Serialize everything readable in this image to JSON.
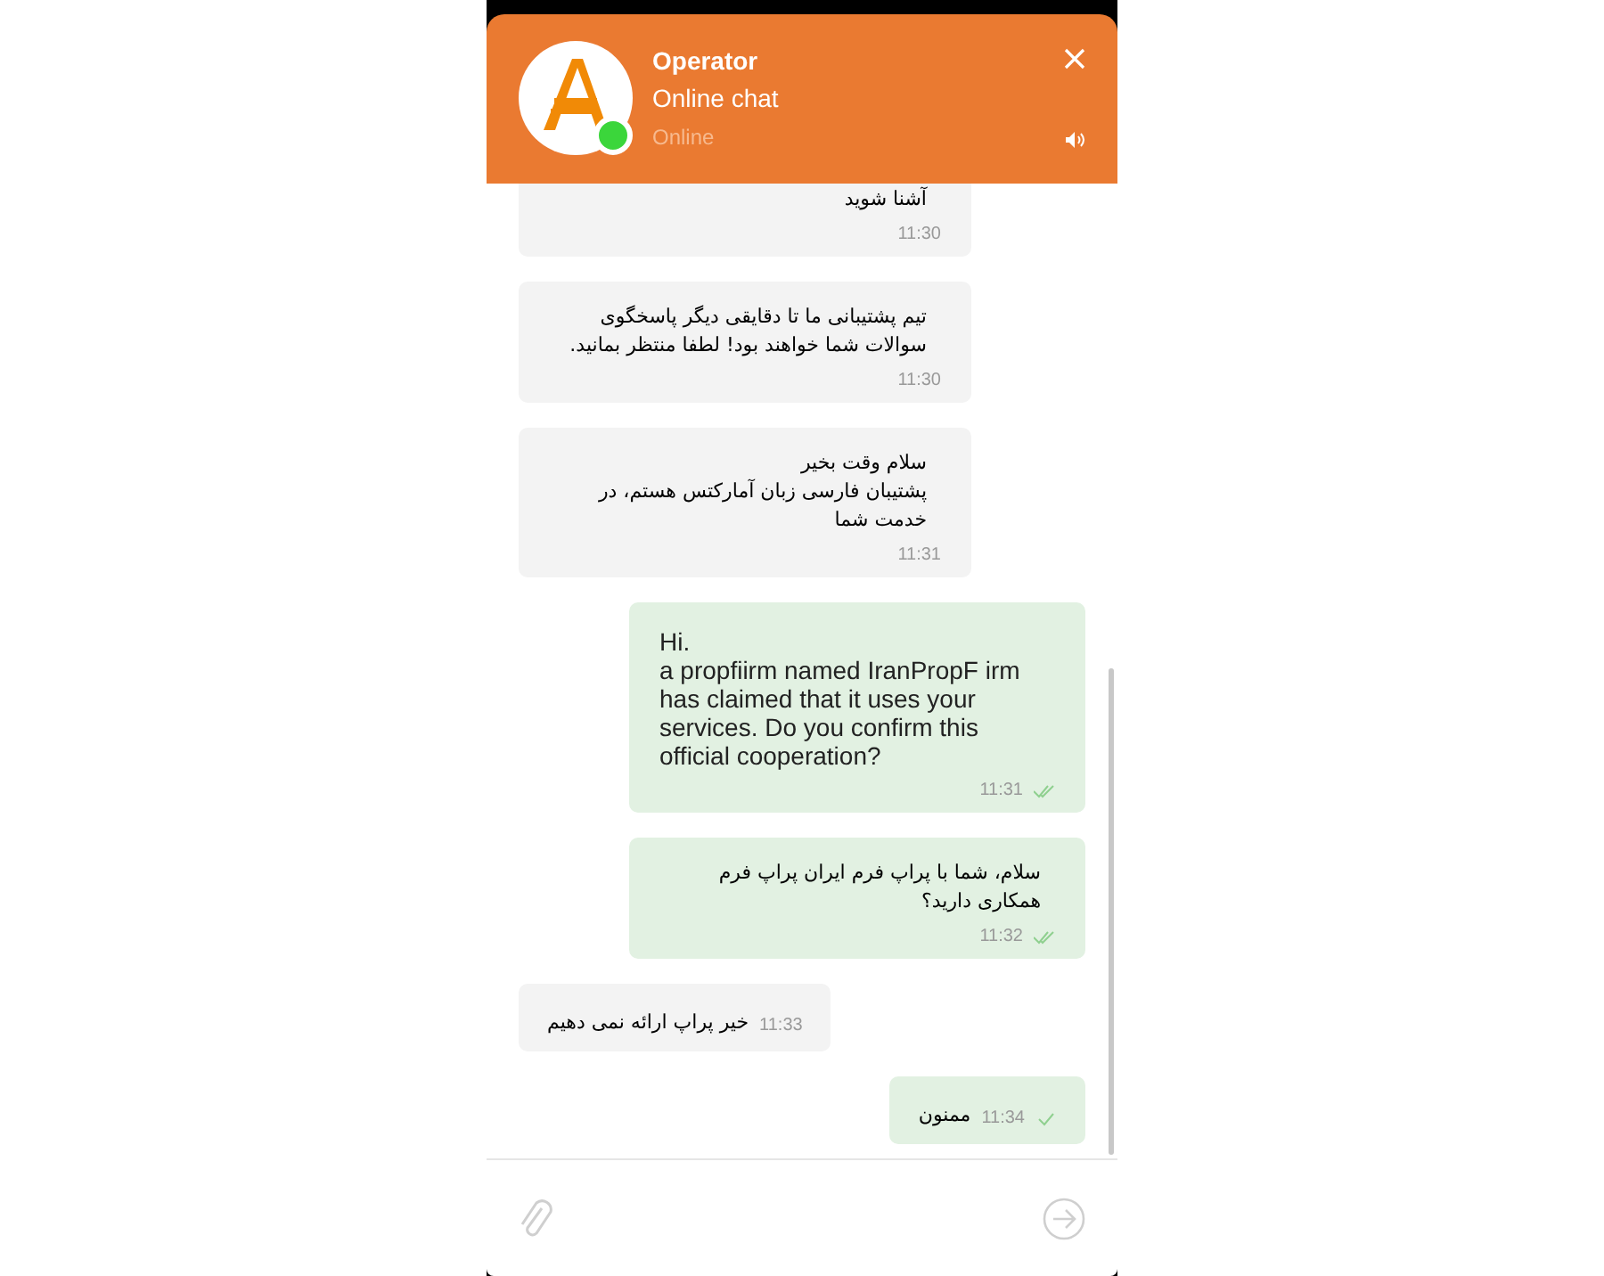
{
  "header": {
    "name": "Operator",
    "subtitle": "Online chat",
    "status": "Online",
    "online": true
  },
  "messages": [
    {
      "outgoing": false,
      "compact": false,
      "text": "آشنا شوید",
      "time": "11:30"
    },
    {
      "outgoing": false,
      "compact": false,
      "text": "تیم پشتیبانی ما تا دقایقی دیگر پاسخگوی سوالات شما خواهند بود! لطفا منتظر بمانید.",
      "time": "11:30"
    },
    {
      "outgoing": false,
      "compact": false,
      "text": "سلام وقت بخیر\nپشتیبان فارسی زبان آمارکتس هستم، در خدمت شما",
      "time": "11:31"
    },
    {
      "outgoing": true,
      "compact": false,
      "text": "Hi.\na propfiirm named IranPropF irm has claimed that it uses your services. Do you confirm this official cooperation?",
      "time": "11:31",
      "read": true
    },
    {
      "outgoing": true,
      "compact": false,
      "text": "سلام، شما با پراپ فرم ایران پراپ فرم همکاری دارید؟",
      "time": "11:32",
      "read": true
    },
    {
      "outgoing": false,
      "compact": true,
      "text": "خیر پراپ ارائه نمی دهیم",
      "time": "11:33"
    },
    {
      "outgoing": true,
      "compact": true,
      "text": "ممنون",
      "time": "11:34",
      "read": false
    }
  ]
}
